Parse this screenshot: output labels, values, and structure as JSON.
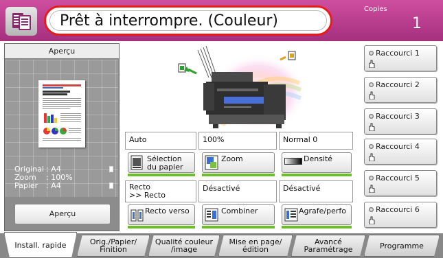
{
  "header": {
    "status": "Prêt à interrompre. (Couleur)",
    "copies_label": "Copies",
    "copies_count": "1"
  },
  "preview": {
    "title": "Aperçu",
    "info": [
      {
        "key": "Original",
        "value": ": A4"
      },
      {
        "key": "Zoom",
        "value": ": 100%"
      },
      {
        "key": "Papier",
        "value": ": A4"
      }
    ],
    "button": "Aperçu"
  },
  "functions": {
    "paper_value": "Auto",
    "paper_button": "Sélection\ndu papier",
    "zoom_value": "100%",
    "zoom_button": "Zoom",
    "density_value": "Normal 0",
    "density_button": "Densité",
    "duplex_value": "Recto\n>> Recto",
    "duplex_button": "Recto verso",
    "combine_value": "Désactivé",
    "combine_button": "Combiner",
    "staple_value": "Désactivé",
    "staple_button": "Agrafe/perfo"
  },
  "shortcuts": [
    "Raccourci 1",
    "Raccourci 2",
    "Raccourci 3",
    "Raccourci 4",
    "Raccourci 5",
    "Raccourci 6"
  ],
  "tabs": [
    "Install. rapide",
    "Orig./Papier/\nFinition",
    "Qualité couleur\n/image",
    "Mise en page/\nédition",
    "Avancé\nParamétrage",
    "Programme"
  ],
  "colors": {
    "header": "#b8388c",
    "status_border": "#e81a1a",
    "accent_green": "#6abf2a"
  }
}
